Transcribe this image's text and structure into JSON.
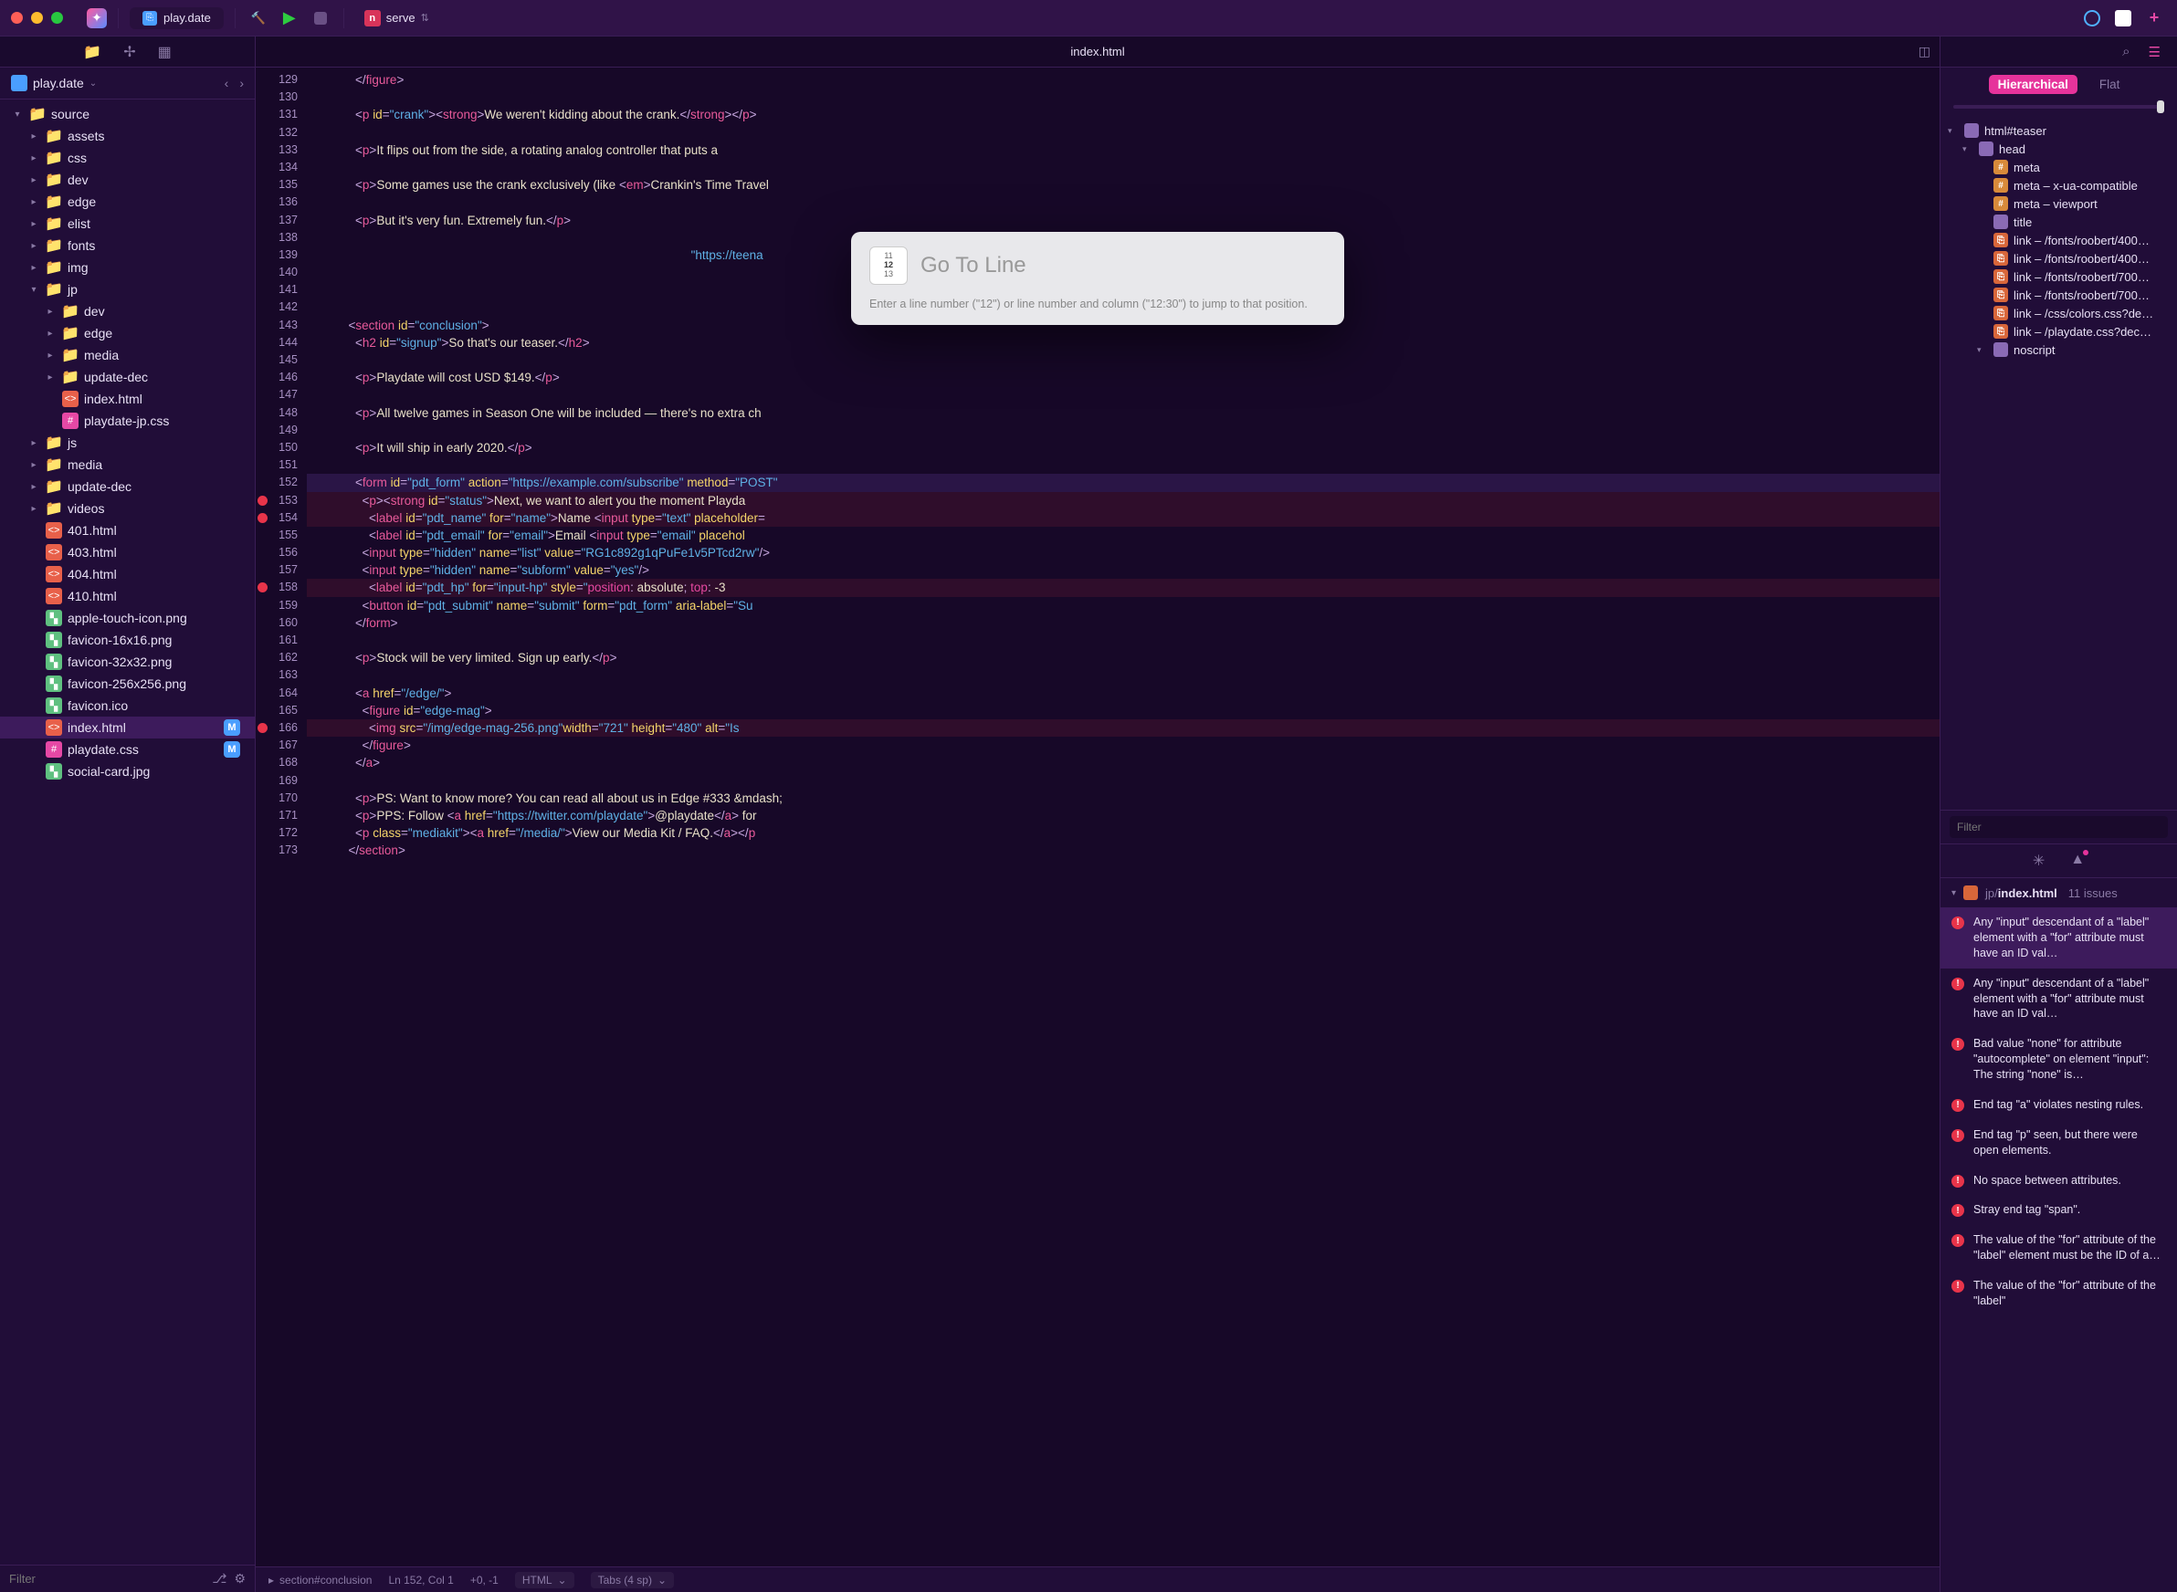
{
  "titlebar": {
    "project_tab": "play.date",
    "run_config": "serve"
  },
  "toolbar_left_icons": [
    "files",
    "symbols",
    "grid"
  ],
  "editor_tab": "index.html",
  "project": {
    "name": "play.date"
  },
  "tree": [
    {
      "d": 0,
      "disc": "▾",
      "type": "folder",
      "label": "source"
    },
    {
      "d": 1,
      "disc": "▸",
      "type": "folder",
      "label": "assets"
    },
    {
      "d": 1,
      "disc": "▸",
      "type": "folder",
      "label": "css"
    },
    {
      "d": 1,
      "disc": "▸",
      "type": "folder",
      "label": "dev"
    },
    {
      "d": 1,
      "disc": "▸",
      "type": "folder",
      "label": "edge"
    },
    {
      "d": 1,
      "disc": "▸",
      "type": "folder",
      "label": "elist"
    },
    {
      "d": 1,
      "disc": "▸",
      "type": "folder",
      "label": "fonts"
    },
    {
      "d": 1,
      "disc": "▸",
      "type": "folder",
      "label": "img"
    },
    {
      "d": 1,
      "disc": "▾",
      "type": "folder",
      "label": "jp"
    },
    {
      "d": 2,
      "disc": "▸",
      "type": "folder",
      "label": "dev"
    },
    {
      "d": 2,
      "disc": "▸",
      "type": "folder",
      "label": "edge"
    },
    {
      "d": 2,
      "disc": "▸",
      "type": "folder",
      "label": "media"
    },
    {
      "d": 2,
      "disc": "▸",
      "type": "folder",
      "label": "update-dec"
    },
    {
      "d": 2,
      "disc": "",
      "type": "html",
      "label": "index.html"
    },
    {
      "d": 2,
      "disc": "",
      "type": "css",
      "label": "playdate-jp.css"
    },
    {
      "d": 1,
      "disc": "▸",
      "type": "folder",
      "label": "js"
    },
    {
      "d": 1,
      "disc": "▸",
      "type": "folder",
      "label": "media"
    },
    {
      "d": 1,
      "disc": "▸",
      "type": "folder",
      "label": "update-dec"
    },
    {
      "d": 1,
      "disc": "▸",
      "type": "folder",
      "label": "videos"
    },
    {
      "d": 1,
      "disc": "",
      "type": "html",
      "label": "401.html"
    },
    {
      "d": 1,
      "disc": "",
      "type": "html",
      "label": "403.html"
    },
    {
      "d": 1,
      "disc": "",
      "type": "html",
      "label": "404.html"
    },
    {
      "d": 1,
      "disc": "",
      "type": "html",
      "label": "410.html"
    },
    {
      "d": 1,
      "disc": "",
      "type": "img",
      "label": "apple-touch-icon.png"
    },
    {
      "d": 1,
      "disc": "",
      "type": "img",
      "label": "favicon-16x16.png"
    },
    {
      "d": 1,
      "disc": "",
      "type": "img",
      "label": "favicon-32x32.png"
    },
    {
      "d": 1,
      "disc": "",
      "type": "img",
      "label": "favicon-256x256.png"
    },
    {
      "d": 1,
      "disc": "",
      "type": "img",
      "label": "favicon.ico"
    },
    {
      "d": 1,
      "disc": "",
      "type": "html",
      "label": "index.html",
      "sel": true,
      "badge": "M"
    },
    {
      "d": 1,
      "disc": "",
      "type": "css",
      "label": "playdate.css",
      "badge": "M"
    },
    {
      "d": 1,
      "disc": "",
      "type": "img",
      "label": "social-card.jpg"
    }
  ],
  "filter_placeholder": "Filter",
  "gutter": {
    "start": 129,
    "end": 173,
    "modified": [
      142,
      152,
      155,
      165
    ],
    "errors": [
      153,
      154,
      158,
      166
    ]
  },
  "code_lines": [
    {
      "n": 129,
      "html": "            <span class='t-punct'>&lt;/</span><span class='t-tag'>figure</span><span class='t-punct'>&gt;</span>"
    },
    {
      "n": 130,
      "html": ""
    },
    {
      "n": 131,
      "html": "            <span class='t-punct'>&lt;</span><span class='t-tag'>p</span> <span class='t-attr'>id</span><span class='t-punct'>=</span><span class='t-str'>\"crank\"</span><span class='t-punct'>&gt;&lt;</span><span class='t-tag'>strong</span><span class='t-punct'>&gt;</span><span class='t-txt'>We weren't kidding about the crank.</span><span class='t-punct'>&lt;/</span><span class='t-tag'>strong</span><span class='t-punct'>&gt;&lt;/</span><span class='t-tag'>p</span><span class='t-punct'>&gt;</span>"
    },
    {
      "n": 132,
      "html": ""
    },
    {
      "n": 133,
      "html": "            <span class='t-punct'>&lt;</span><span class='t-tag'>p</span><span class='t-punct'>&gt;</span><span class='t-txt'>It flips out from the side, a rotating analog controller that puts a </span>"
    },
    {
      "n": 134,
      "html": ""
    },
    {
      "n": 135,
      "html": "            <span class='t-punct'>&lt;</span><span class='t-tag'>p</span><span class='t-punct'>&gt;</span><span class='t-txt'>Some games use the crank exclusively (like </span><span class='t-punct'>&lt;</span><span class='t-tag'>em</span><span class='t-punct'>&gt;</span><span class='t-txt'>Crankin's Time Travel</span>"
    },
    {
      "n": 136,
      "html": ""
    },
    {
      "n": 137,
      "html": "            <span class='t-punct'>&lt;</span><span class='t-tag'>p</span><span class='t-punct'>&gt;</span><span class='t-txt'>But it's very fun. Extremely fun.</span><span class='t-punct'>&lt;/</span><span class='t-tag'>p</span><span class='t-punct'>&gt;</span>"
    },
    {
      "n": 138,
      "html": ""
    },
    {
      "n": 139,
      "html": "                                                                                                              <span class='t-str'>\"https://teena</span>"
    },
    {
      "n": 140,
      "html": ""
    },
    {
      "n": 141,
      "html": ""
    },
    {
      "n": 142,
      "html": ""
    },
    {
      "n": 143,
      "html": "          <span class='t-punct'>&lt;</span><span class='t-tag'>section</span> <span class='t-attr'>id</span><span class='t-punct'>=</span><span class='t-str'>\"conclusion\"</span><span class='t-punct'>&gt;</span>"
    },
    {
      "n": 144,
      "html": "            <span class='t-punct'>&lt;</span><span class='t-tag'>h2</span> <span class='t-attr'>id</span><span class='t-punct'>=</span><span class='t-str'>\"signup\"</span><span class='t-punct'>&gt;</span><span class='t-txt'>So that's our teaser.</span><span class='t-punct'>&lt;/</span><span class='t-tag'>h2</span><span class='t-punct'>&gt;</span>"
    },
    {
      "n": 145,
      "html": ""
    },
    {
      "n": 146,
      "html": "            <span class='t-punct'>&lt;</span><span class='t-tag'>p</span><span class='t-punct'>&gt;</span><span class='t-txt'>Playdate will cost USD $149.</span><span class='t-punct'>&lt;/</span><span class='t-tag'>p</span><span class='t-punct'>&gt;</span>"
    },
    {
      "n": 147,
      "html": ""
    },
    {
      "n": 148,
      "html": "            <span class='t-punct'>&lt;</span><span class='t-tag'>p</span><span class='t-punct'>&gt;</span><span class='t-txt'>All twelve games in Season One will be included — there's no extra ch</span>"
    },
    {
      "n": 149,
      "html": ""
    },
    {
      "n": 150,
      "html": "            <span class='t-punct'>&lt;</span><span class='t-tag'>p</span><span class='t-punct'>&gt;</span><span class='t-txt'>It will ship in early 2020.</span><span class='t-punct'>&lt;/</span><span class='t-tag'>p</span><span class='t-punct'>&gt;</span>"
    },
    {
      "n": 151,
      "html": ""
    },
    {
      "n": 152,
      "hl": true,
      "html": "            <span class='t-punct'>&lt;</span><span class='t-tag'>form</span> <span class='t-attr'>id</span><span class='t-punct'>=</span><span class='t-str'>\"pdt_form\"</span> <span class='t-attr'>action</span><span class='t-punct'>=</span><span class='t-str'>\"https://example.com/subscribe\"</span> <span class='t-attr'>method</span><span class='t-punct'>=</span><span class='t-str'>\"POST\"</span>"
    },
    {
      "n": 153,
      "hlerr": true,
      "html": "              <span class='t-punct'>&lt;</span><span class='t-tag'>p</span><span class='t-punct'>&gt;&lt;</span><span class='t-tag'>strong</span> <span class='t-attr'>id</span><span class='t-punct'>=</span><span class='t-str'>\"status\"</span><span class='t-punct'>&gt;</span><span class='t-txt'>Next, we want to alert you the moment Playda</span>"
    },
    {
      "n": 154,
      "hlerr": true,
      "html": "                <span class='t-punct'>&lt;</span><span class='t-tag'>label</span> <span class='t-attr'>id</span><span class='t-punct'>=</span><span class='t-str'>\"pdt_name\"</span> <span class='t-attr'>for</span><span class='t-punct'>=</span><span class='t-str'>\"name\"</span><span class='t-punct'>&gt;</span><span class='t-txt'>Name </span><span class='t-punct'>&lt;</span><span class='t-tag'>input</span> <span class='t-attr'>type</span><span class='t-punct'>=</span><span class='t-str'>\"text\"</span> <span class='t-attr'>placeholder</span><span class='t-punct'>=</span>"
    },
    {
      "n": 155,
      "html": "                <span class='t-punct'>&lt;</span><span class='t-tag'>label</span> <span class='t-attr'>id</span><span class='t-punct'>=</span><span class='t-str'>\"pdt_email\"</span> <span class='t-attr'>for</span><span class='t-punct'>=</span><span class='t-str'>\"email\"</span><span class='t-punct'>&gt;</span><span class='t-txt'>Email </span><span class='t-punct'>&lt;</span><span class='t-tag'>input</span> <span class='t-attr'>type</span><span class='t-punct'>=</span><span class='t-str'>\"email\"</span> <span class='t-attr'>placehol</span>"
    },
    {
      "n": 156,
      "html": "              <span class='t-punct'>&lt;</span><span class='t-tag'>input</span> <span class='t-attr'>type</span><span class='t-punct'>=</span><span class='t-str'>\"hidden\"</span> <span class='t-attr'>name</span><span class='t-punct'>=</span><span class='t-str'>\"list\"</span> <span class='t-attr'>value</span><span class='t-punct'>=</span><span class='t-str'>\"RG1c892g1qPuFe1v5PTcd2rw\"</span><span class='t-punct'>/&gt;</span>"
    },
    {
      "n": 157,
      "html": "              <span class='t-punct'>&lt;</span><span class='t-tag'>input</span> <span class='t-attr'>type</span><span class='t-punct'>=</span><span class='t-str'>\"hidden\"</span> <span class='t-attr'>name</span><span class='t-punct'>=</span><span class='t-str'>\"subform\"</span> <span class='t-attr'>value</span><span class='t-punct'>=</span><span class='t-str'>\"yes\"</span><span class='t-punct'>/&gt;</span>"
    },
    {
      "n": 158,
      "hlerr": true,
      "html": "                <span class='t-punct'>&lt;</span><span class='t-tag'>label</span> <span class='t-attr'>id</span><span class='t-punct'>=</span><span class='t-str'>\"pdt_hp\"</span> <span class='t-attr'>for</span><span class='t-punct'>=</span><span class='t-str'>\"input-hp\"</span> <span class='t-attr'>style</span><span class='t-punct'>=</span><span class='t-str'>\"</span><span class='t-kw'>position</span><span class='t-punct'>:</span> <span class='t-txt'>absolute</span><span class='t-punct'>;</span> <span class='t-kw'>top</span><span class='t-punct'>:</span> <span class='t-txt'>-3</span>"
    },
    {
      "n": 159,
      "html": "              <span class='t-punct'>&lt;</span><span class='t-tag'>button</span> <span class='t-attr'>id</span><span class='t-punct'>=</span><span class='t-str'>\"pdt_submit\"</span> <span class='t-attr'>name</span><span class='t-punct'>=</span><span class='t-str'>\"submit\"</span> <span class='t-attr'>form</span><span class='t-punct'>=</span><span class='t-str'>\"pdt_form\"</span> <span class='t-attr'>aria-label</span><span class='t-punct'>=</span><span class='t-str'>\"Su</span>"
    },
    {
      "n": 160,
      "html": "            <span class='t-punct'>&lt;/</span><span class='t-tag'>form</span><span class='t-punct'>&gt;</span>"
    },
    {
      "n": 161,
      "html": ""
    },
    {
      "n": 162,
      "html": "            <span class='t-punct'>&lt;</span><span class='t-tag'>p</span><span class='t-punct'>&gt;</span><span class='t-txt'>Stock will be very limited. Sign up early.</span><span class='t-punct'>&lt;/</span><span class='t-tag'>p</span><span class='t-punct'>&gt;</span>"
    },
    {
      "n": 163,
      "html": ""
    },
    {
      "n": 164,
      "html": "            <span class='t-punct'>&lt;</span><span class='t-tag'>a</span> <span class='t-attr'>href</span><span class='t-punct'>=</span><span class='t-str'>\"/edge/\"</span><span class='t-punct'>&gt;</span>"
    },
    {
      "n": 165,
      "html": "              <span class='t-punct'>&lt;</span><span class='t-tag'>figure</span> <span class='t-attr'>id</span><span class='t-punct'>=</span><span class='t-str'>\"edge-mag\"</span><span class='t-punct'>&gt;</span>"
    },
    {
      "n": 166,
      "hlerr": true,
      "html": "                <span class='t-punct'>&lt;</span><span class='t-tag'>img</span> <span class='t-attr'>src</span><span class='t-punct'>=</span><span class='t-str'>\"/img/edge-mag-256.png\"</span><span class='t-attr'>width</span><span class='t-punct'>=</span><span class='t-str'>\"721\"</span> <span class='t-attr'>height</span><span class='t-punct'>=</span><span class='t-str'>\"480\"</span> <span class='t-attr'>alt</span><span class='t-punct'>=</span><span class='t-str'>\"Is</span>"
    },
    {
      "n": 167,
      "html": "              <span class='t-punct'>&lt;/</span><span class='t-tag'>figure</span><span class='t-punct'>&gt;</span>"
    },
    {
      "n": 168,
      "html": "            <span class='t-punct'>&lt;/</span><span class='t-tag'>a</span><span class='t-punct'>&gt;</span>"
    },
    {
      "n": 169,
      "html": ""
    },
    {
      "n": 170,
      "html": "            <span class='t-punct'>&lt;</span><span class='t-tag'>p</span><span class='t-punct'>&gt;</span><span class='t-txt'>PS: Want to know more? You can read all about us in Edge #333 &amp;mdash;</span>"
    },
    {
      "n": 171,
      "html": "            <span class='t-punct'>&lt;</span><span class='t-tag'>p</span><span class='t-punct'>&gt;</span><span class='t-txt'>PPS: Follow </span><span class='t-punct'>&lt;</span><span class='t-tag'>a</span> <span class='t-attr'>href</span><span class='t-punct'>=</span><span class='t-str'>\"https://twitter.com/playdate\"</span><span class='t-punct'>&gt;</span><span class='t-txt'>@playdate</span><span class='t-punct'>&lt;/</span><span class='t-tag'>a</span><span class='t-punct'>&gt;</span><span class='t-txt'> for</span>"
    },
    {
      "n": 172,
      "html": "            <span class='t-punct'>&lt;</span><span class='t-tag'>p</span> <span class='t-attr'>class</span><span class='t-punct'>=</span><span class='t-str'>\"mediakit\"</span><span class='t-punct'>&gt;&lt;</span><span class='t-tag'>a</span> <span class='t-attr'>href</span><span class='t-punct'>=</span><span class='t-str'>\"/media/\"</span><span class='t-punct'>&gt;</span><span class='t-txt'>View our Media Kit / FAQ.</span><span class='t-punct'>&lt;/</span><span class='t-tag'>a</span><span class='t-punct'>&gt;&lt;/</span><span class='t-tag'>p</span>"
    },
    {
      "n": 173,
      "html": "          <span class='t-punct'>&lt;/</span><span class='t-tag'>section</span><span class='t-punct'>&gt;</span>"
    }
  ],
  "modal": {
    "title": "Go To Line",
    "icon_lines": [
      "11",
      "12",
      "13"
    ],
    "hint": "Enter a line number (\"12\") or line number and column (\"12:30\") to jump to that position."
  },
  "status": {
    "breadcrumb": "section#conclusion",
    "cursor": "Ln 152, Col 1",
    "diff": "+0, -1",
    "lang": "HTML",
    "indent": "Tabs (4 sp)"
  },
  "right": {
    "tabs": {
      "hierarchical": "Hierarchical",
      "flat": "Flat"
    },
    "outline": [
      {
        "d": 0,
        "disc": "▾",
        "kind": "el",
        "label": "html#teaser"
      },
      {
        "d": 1,
        "disc": "▾",
        "kind": "el",
        "label": "head"
      },
      {
        "d": 2,
        "disc": "",
        "kind": "meta",
        "label": "meta"
      },
      {
        "d": 2,
        "disc": "",
        "kind": "meta",
        "label": "meta – x-ua-compatible"
      },
      {
        "d": 2,
        "disc": "",
        "kind": "meta",
        "label": "meta – viewport"
      },
      {
        "d": 2,
        "disc": "",
        "kind": "el",
        "label": "title"
      },
      {
        "d": 2,
        "disc": "",
        "kind": "link",
        "label": "link – /fonts/roobert/400…"
      },
      {
        "d": 2,
        "disc": "",
        "kind": "link",
        "label": "link – /fonts/roobert/400…"
      },
      {
        "d": 2,
        "disc": "",
        "kind": "link",
        "label": "link – /fonts/roobert/700…"
      },
      {
        "d": 2,
        "disc": "",
        "kind": "link",
        "label": "link – /fonts/roobert/700…"
      },
      {
        "d": 2,
        "disc": "",
        "kind": "link",
        "label": "link – /css/colors.css?de…"
      },
      {
        "d": 2,
        "disc": "",
        "kind": "link",
        "label": "link – /playdate.css?dec…"
      },
      {
        "d": 2,
        "disc": "▾",
        "kind": "el",
        "label": "noscript"
      }
    ],
    "outline_filter": "Filter",
    "issues_file_path": "jp/",
    "issues_file_name": "index.html",
    "issues_count": "11 issues",
    "issues": [
      {
        "sel": true,
        "text": "Any \"input\" descendant of a \"label\" element with a \"for\" attribute must have an ID val…"
      },
      {
        "text": "Any \"input\" descendant of a \"label\" element with a \"for\" attribute must have an ID val…"
      },
      {
        "text": "Bad value \"none\" for attribute \"autocomplete\" on element \"input\": The string \"none\" is…"
      },
      {
        "text": "End tag \"a\" violates nesting rules."
      },
      {
        "text": "End tag \"p\" seen, but there were open elements."
      },
      {
        "text": "No space between attributes."
      },
      {
        "text": "Stray end tag \"span\"."
      },
      {
        "text": "The value of the \"for\" attribute of the \"label\" element must be the ID of a…"
      },
      {
        "text": "The value of the \"for\" attribute of the \"label\""
      }
    ]
  }
}
